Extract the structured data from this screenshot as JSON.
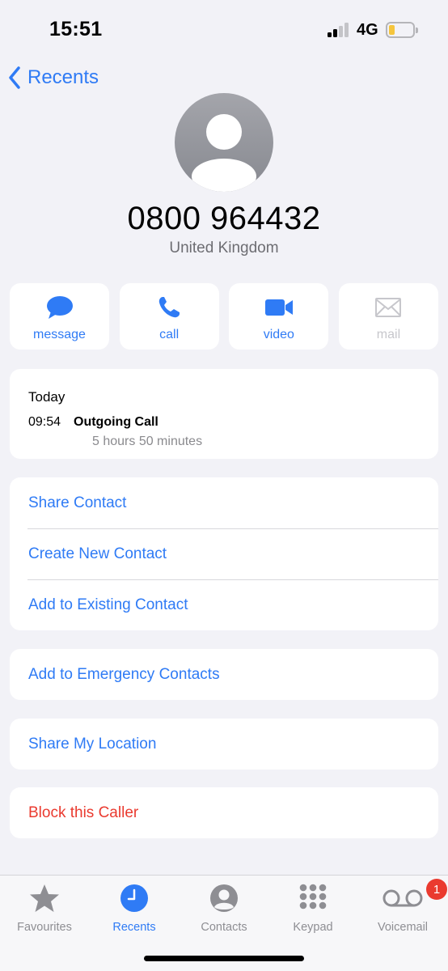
{
  "status_bar": {
    "time": "15:51",
    "network": "4G",
    "signal_bars": 2,
    "battery_level": 0.2
  },
  "nav": {
    "back_label": "Recents"
  },
  "contact": {
    "number": "0800 964432",
    "country": "United Kingdom"
  },
  "actions": [
    {
      "label": "message",
      "icon": "message-icon",
      "enabled": true
    },
    {
      "label": "call",
      "icon": "phone-icon",
      "enabled": true
    },
    {
      "label": "video",
      "icon": "video-icon",
      "enabled": true
    },
    {
      "label": "mail",
      "icon": "mail-icon",
      "enabled": false
    }
  ],
  "history": {
    "day": "Today",
    "entries": [
      {
        "time": "09:54",
        "type": "Outgoing Call",
        "duration": "5 hours 50 minutes"
      }
    ]
  },
  "contact_options": [
    "Share Contact",
    "Create New Contact",
    "Add to Existing Contact"
  ],
  "emergency": "Add to Emergency Contacts",
  "location": "Share My Location",
  "block": "Block this Caller",
  "tab_bar": {
    "tabs": [
      {
        "label": "Favourites",
        "icon": "star-icon",
        "active": false
      },
      {
        "label": "Recents",
        "icon": "clock-icon",
        "active": true
      },
      {
        "label": "Contacts",
        "icon": "person-circle-icon",
        "active": false
      },
      {
        "label": "Keypad",
        "icon": "keypad-icon",
        "active": false
      },
      {
        "label": "Voicemail",
        "icon": "voicemail-icon",
        "active": false,
        "badge": "1"
      }
    ]
  },
  "colors": {
    "accent": "#2f7bf5",
    "destructive": "#ea3a2f",
    "background": "#f2f2f7",
    "secondary_text": "#8a8a8e"
  }
}
